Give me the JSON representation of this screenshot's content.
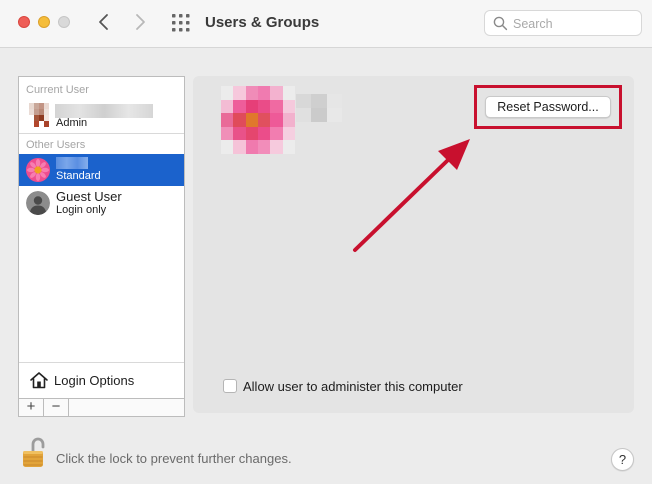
{
  "window": {
    "title": "Users & Groups"
  },
  "search": {
    "placeholder": "Search"
  },
  "sidebar": {
    "current_user_header": "Current User",
    "current_user": {
      "role": "Admin"
    },
    "other_users_header": "Other Users",
    "users": [
      {
        "role": "Standard",
        "selected": true
      },
      {
        "name": "Guest User",
        "role": "Login only",
        "selected": false
      }
    ],
    "login_options_label": "Login Options",
    "add_label": "+",
    "remove_label": "−"
  },
  "detail": {
    "reset_password_label": "Reset Password...",
    "allow_admin_label": "Allow user to administer this computer",
    "allow_admin_checked": false
  },
  "footer": {
    "lock_text": "Click the lock to prevent further changes.",
    "help_label": "?"
  },
  "colors": {
    "selection_blue": "#1b62cc",
    "annotation_red": "#c8102e",
    "traffic_close": "#ee5e57",
    "traffic_minimize": "#f5bd3a"
  }
}
